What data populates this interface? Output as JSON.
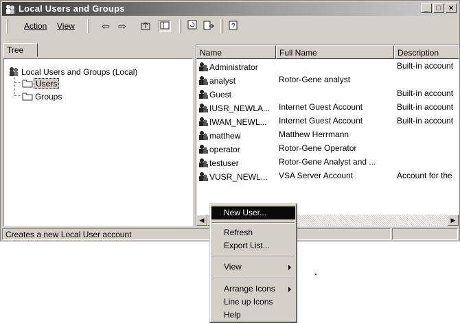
{
  "window": {
    "title": "Local Users and Groups",
    "controls": {
      "minimize": "_",
      "maximize": "□",
      "close": "×"
    }
  },
  "menu": {
    "action": "Action",
    "view": "View"
  },
  "toolbar_icons": [
    "back-arrow-icon",
    "forward-arrow-icon",
    "up-folder-icon",
    "show-tree-icon",
    "refresh-icon",
    "export-list-icon",
    "help-icon"
  ],
  "tree": {
    "tab": "Tree",
    "root": "Local Users and Groups (Local)",
    "children": [
      "Users",
      "Groups"
    ]
  },
  "list": {
    "columns": [
      "Name",
      "Full Name",
      "Description"
    ],
    "rows": [
      {
        "name": "Administrator",
        "full": "",
        "desc": "Built-in account"
      },
      {
        "name": "analyst",
        "full": "Rotor-Gene analyst",
        "desc": ""
      },
      {
        "name": "Guest",
        "full": "",
        "desc": "Built-in account"
      },
      {
        "name": "IUSR_NEWLA...",
        "full": "Internet Guest Account",
        "desc": "Built-in account"
      },
      {
        "name": "IWAM_NEWL...",
        "full": "Internet Guest Account",
        "desc": "Built-in account"
      },
      {
        "name": "matthew",
        "full": "Matthew Herrmann",
        "desc": ""
      },
      {
        "name": "operator",
        "full": "Rotor-Gene Operator",
        "desc": ""
      },
      {
        "name": "testuser",
        "full": "Rotor-Gene Analyst and ...",
        "desc": ""
      },
      {
        "name": "VUSR_NEWL...",
        "full": "VSA Server Account",
        "desc": "Account for the"
      }
    ]
  },
  "status": {
    "text": "Creates a new Local User account"
  },
  "context_menu": {
    "new_user": "New User...",
    "refresh": "Refresh",
    "export": "Export List...",
    "view": "View",
    "arrange": "Arrange Icons",
    "lineup": "Line up Icons",
    "help": "Help"
  }
}
